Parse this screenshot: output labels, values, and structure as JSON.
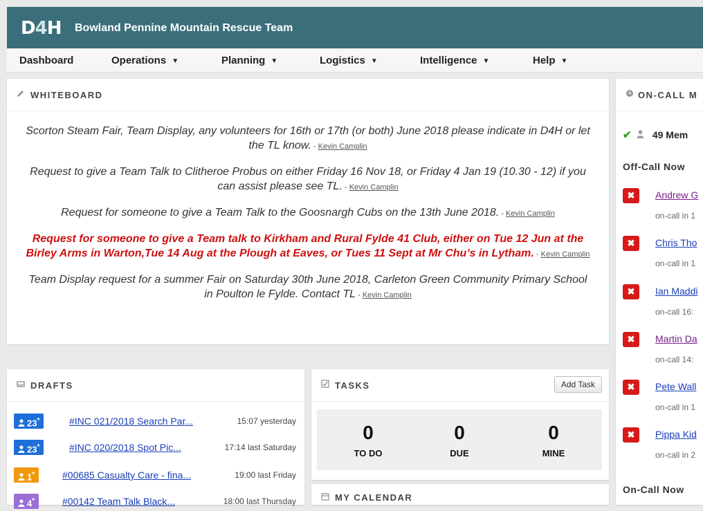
{
  "header": {
    "logo_d": "D",
    "logo_4": "4",
    "logo_h": "H",
    "team_name": "Bowland Pennine Mountain Rescue Team",
    "bar_color": "#3a6e7a"
  },
  "nav": {
    "items": [
      {
        "label": "Dashboard",
        "dropdown": false
      },
      {
        "label": "Operations",
        "dropdown": true
      },
      {
        "label": "Planning",
        "dropdown": true
      },
      {
        "label": "Logistics",
        "dropdown": true
      },
      {
        "label": "Intelligence",
        "dropdown": true
      },
      {
        "label": "Help",
        "dropdown": true
      }
    ],
    "caret": "▼"
  },
  "whiteboard": {
    "title": "WHITEBOARD",
    "icon": "pencil-icon",
    "notes": [
      {
        "text": "Scorton Steam Fair, Team Display, any volunteers for 16th or 17th (or both) June 2018 please indicate in D4H or let the TL know.",
        "author": "Kevin Camplin",
        "urgent": false
      },
      {
        "text": "Request to give a Team Talk to Clitheroe Probus on either Friday 16 Nov 18, or Friday 4 Jan 19 (10.30 - 12) if you can assist please see TL.",
        "author": "Kevin Camplin",
        "urgent": false
      },
      {
        "text": "Request for someone to give a Team Talk to the Goosnargh Cubs on the 13th June 2018.",
        "author": "Kevin Camplin",
        "urgent": false
      },
      {
        "text": "Request for someone to give a Team talk to Kirkham and Rural Fylde 41 Club, either on Tue 12 Jun at the Birley Arms in Warton,Tue 14 Aug at the Plough at Eaves, or Tues 11 Sept at Mr Chu’s in Lytham.",
        "author": "Kevin Camplin",
        "urgent": true
      },
      {
        "text": "Team Display request for a summer Fair on Saturday 30th June 2018, Carleton Green Community Primary School in Poulton le Fylde. Contact TL",
        "author": "Kevin Camplin",
        "urgent": false
      }
    ],
    "separator": "- "
  },
  "drafts": {
    "title": "DRAFTS",
    "icon": "inbox-icon",
    "items": [
      {
        "badge_count": "23",
        "badge_star": "*",
        "badge_color": "#1e6fd9",
        "title": "#INC 021/2018 Search Par...",
        "time": "15:07 yesterday"
      },
      {
        "badge_count": "23",
        "badge_star": "*",
        "badge_color": "#1e6fd9",
        "title": "#INC 020/2018 Spot Pic...",
        "time": "17:14 last Saturday"
      },
      {
        "badge_count": "1",
        "badge_star": "*",
        "badge_color": "#f0980e",
        "title": "#00685 Casualty Care - fina...",
        "time": "19:00 last Friday"
      },
      {
        "badge_count": "4",
        "badge_star": "*",
        "badge_color": "#9b6fd6",
        "title": "#00142 Team Talk Black...",
        "time": "18:00 last Thursday"
      }
    ]
  },
  "tasks": {
    "title": "TASKS",
    "icon": "checkbox-icon",
    "add_label": "Add Task",
    "counts": [
      {
        "value": "0",
        "label": "TO DO"
      },
      {
        "value": "0",
        "label": "DUE"
      },
      {
        "value": "0",
        "label": "MINE"
      }
    ]
  },
  "calendar": {
    "title": "MY CALENDAR",
    "icon": "calendar-icon"
  },
  "oncall": {
    "title": "ON-CALL M",
    "icon": "clock-icon",
    "summary": "49 Mem",
    "off_call_label": "Off-Call Now",
    "on_call_label": "On-Call Now",
    "members": [
      {
        "name": "Andrew G",
        "sub": "on-call in 1",
        "color": "#7a1f8a"
      },
      {
        "name": "Chris Tho",
        "sub": "on-call in 1",
        "color": "#1a3eb8"
      },
      {
        "name": "Ian Maddi",
        "sub": "on-call 16:",
        "color": "#1a3eb8"
      },
      {
        "name": "Martin Da",
        "sub": "on-call 14:",
        "color": "#7a1f8a"
      },
      {
        "name": "Pete Wall",
        "sub": "on-call in 1",
        "color": "#1a3eb8"
      },
      {
        "name": "Pippa Kid",
        "sub": "on-call in 2",
        "color": "#1a3eb8"
      }
    ],
    "x_glyph": "✖",
    "check_glyph": "✔"
  }
}
